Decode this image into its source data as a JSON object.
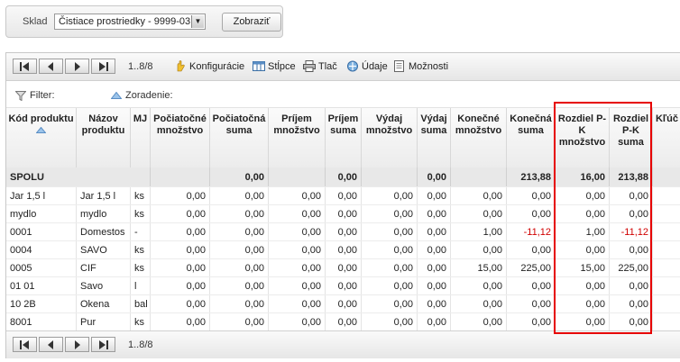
{
  "top": {
    "warehouse_label": "Sklad",
    "warehouse_value": "Čistiace prostriedky - 9999-03",
    "show_button": "Zobraziť"
  },
  "toolbar": {
    "pager_info": "1..8/8",
    "configuration": "Konfigurácie",
    "columns": "Stĺpce",
    "print": "Tlač",
    "data": "Údaje",
    "options": "Možnosti"
  },
  "filterbar": {
    "filter_label": "Filter:",
    "sort_label": "Zoradenie:"
  },
  "columns": {
    "code": "Kód produktu",
    "name": "Názov produktu",
    "unit": "MJ",
    "init_qty": "Počiatočné množstvo",
    "init_sum": "Počiatočná suma",
    "in_qty": "Príjem množstvo",
    "in_sum": "Príjem suma",
    "out_qty": "Výdaj množstvo",
    "out_sum": "Výdaj suma",
    "end_qty": "Konečné množstvo",
    "end_sum": "Konečná suma",
    "diff_qty": "Rozdiel P-K množstvo",
    "diff_sum": "Rozdiel P-K suma",
    "key": "Kľúč"
  },
  "summary": {
    "label": "SPOLU",
    "init_sum": "0,00",
    "in_sum": "0,00",
    "out_sum": "0,00",
    "end_sum": "213,88",
    "diff_qty": "16,00",
    "diff_sum": "213,88"
  },
  "rows": [
    {
      "code": "Jar 1,5 l",
      "name": "Jar 1,5 l",
      "unit": "ks",
      "init_qty": "0,00",
      "init_sum": "0,00",
      "in_qty": "0,00",
      "in_sum": "0,00",
      "out_qty": "0,00",
      "out_sum": "0,00",
      "end_qty": "0,00",
      "end_sum": "0,00",
      "diff_qty": "0,00",
      "diff_sum": "0,00"
    },
    {
      "code": "mydlo",
      "name": "mydlo",
      "unit": "ks",
      "init_qty": "0,00",
      "init_sum": "0,00",
      "in_qty": "0,00",
      "in_sum": "0,00",
      "out_qty": "0,00",
      "out_sum": "0,00",
      "end_qty": "0,00",
      "end_sum": "0,00",
      "diff_qty": "0,00",
      "diff_sum": "0,00"
    },
    {
      "code": "0001",
      "name": "Domestos",
      "unit": "-",
      "init_qty": "0,00",
      "init_sum": "0,00",
      "in_qty": "0,00",
      "in_sum": "0,00",
      "out_qty": "0,00",
      "out_sum": "0,00",
      "end_qty": "1,00",
      "end_sum": "-11,12",
      "diff_qty": "1,00",
      "diff_sum": "-11,12"
    },
    {
      "code": "0004",
      "name": "SAVO",
      "unit": "ks",
      "init_qty": "0,00",
      "init_sum": "0,00",
      "in_qty": "0,00",
      "in_sum": "0,00",
      "out_qty": "0,00",
      "out_sum": "0,00",
      "end_qty": "0,00",
      "end_sum": "0,00",
      "diff_qty": "0,00",
      "diff_sum": "0,00"
    },
    {
      "code": "0005",
      "name": "CIF",
      "unit": "ks",
      "init_qty": "0,00",
      "init_sum": "0,00",
      "in_qty": "0,00",
      "in_sum": "0,00",
      "out_qty": "0,00",
      "out_sum": "0,00",
      "end_qty": "15,00",
      "end_sum": "225,00",
      "diff_qty": "15,00",
      "diff_sum": "225,00"
    },
    {
      "code": "01 01",
      "name": "Savo",
      "unit": "l",
      "init_qty": "0,00",
      "init_sum": "0,00",
      "in_qty": "0,00",
      "in_sum": "0,00",
      "out_qty": "0,00",
      "out_sum": "0,00",
      "end_qty": "0,00",
      "end_sum": "0,00",
      "diff_qty": "0,00",
      "diff_sum": "0,00"
    },
    {
      "code": "10 2B",
      "name": "Okena",
      "unit": "bal",
      "init_qty": "0,00",
      "init_sum": "0,00",
      "in_qty": "0,00",
      "in_sum": "0,00",
      "out_qty": "0,00",
      "out_sum": "0,00",
      "end_qty": "0,00",
      "end_sum": "0,00",
      "diff_qty": "0,00",
      "diff_sum": "0,00"
    },
    {
      "code": "8001",
      "name": "Pur",
      "unit": "ks",
      "init_qty": "0,00",
      "init_sum": "0,00",
      "in_qty": "0,00",
      "in_sum": "0,00",
      "out_qty": "0,00",
      "out_sum": "0,00",
      "end_qty": "0,00",
      "end_sum": "0,00",
      "diff_qty": "0,00",
      "diff_sum": "0,00"
    }
  ],
  "colors": {
    "negative": "#d00000",
    "highlight": "#e60000"
  }
}
